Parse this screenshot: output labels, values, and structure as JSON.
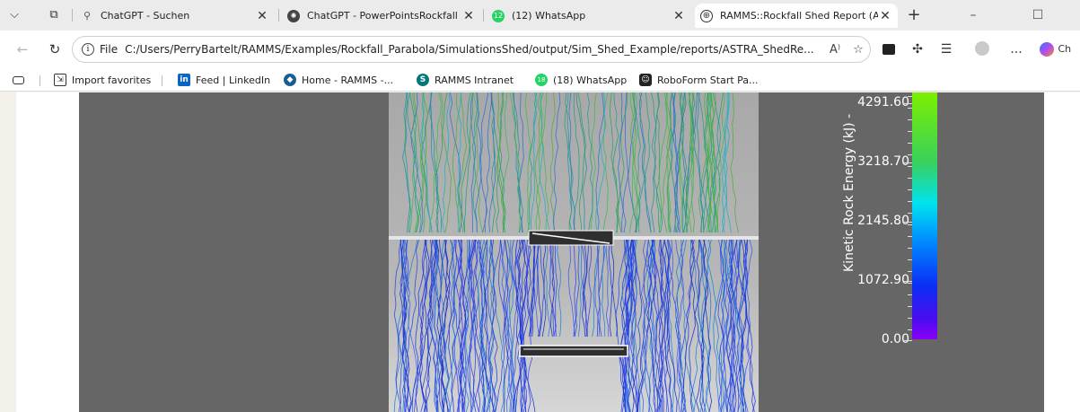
{
  "tabs": [
    {
      "label": "ChatGPT - Suchen",
      "favicon": "search-icon",
      "active": false
    },
    {
      "label": "ChatGPT - PowerPointsRockfall",
      "favicon": "openai-icon",
      "active": false
    },
    {
      "label": "(12) WhatsApp",
      "favicon": "whatsapp-icon",
      "active": false
    },
    {
      "label": "RAMMS::Rockfall Shed Report (AST",
      "favicon": "globe-icon",
      "active": true
    }
  ],
  "address": {
    "scheme": "File",
    "url": "C:/Users/PerryBartelt/RAMMS/Examples/Rockfall_Parabola/SimulationsShed/output/Sim_Shed_Example/reports/ASTRA_ShedRe..."
  },
  "toolbar": {
    "copilot_label": "Ch",
    "more_label": "..."
  },
  "favorites": [
    {
      "label": "Import favorites",
      "icon": "folder-import-icon"
    },
    {
      "label": "Feed | LinkedIn",
      "icon": "linkedin-icon",
      "icon_text": "in"
    },
    {
      "label": "Home - RAMMS -...",
      "icon": "ramms-icon"
    },
    {
      "label": "RAMMS Intranet",
      "icon": "sharepoint-icon",
      "icon_text": "S"
    },
    {
      "label": "(18) WhatsApp",
      "icon": "whatsapp-icon",
      "icon_text": "18"
    },
    {
      "label": "RoboForm Start Pa...",
      "icon": "roboform-icon"
    }
  ],
  "viewer": {
    "colorbar": {
      "title": "Kinetic Rock Energy (kJ) - ",
      "labels": [
        "4291.60",
        "3218.70",
        "2145.80",
        "1072.90",
        "0.00"
      ],
      "values": [
        4291.6,
        3218.7,
        2145.8,
        1072.9,
        0.0
      ]
    }
  },
  "colors": {
    "viewer_bg": "#666666",
    "accent_active_tab": "#ffffff",
    "whatsapp": "#25d366",
    "linkedin": "#0a66c2"
  }
}
